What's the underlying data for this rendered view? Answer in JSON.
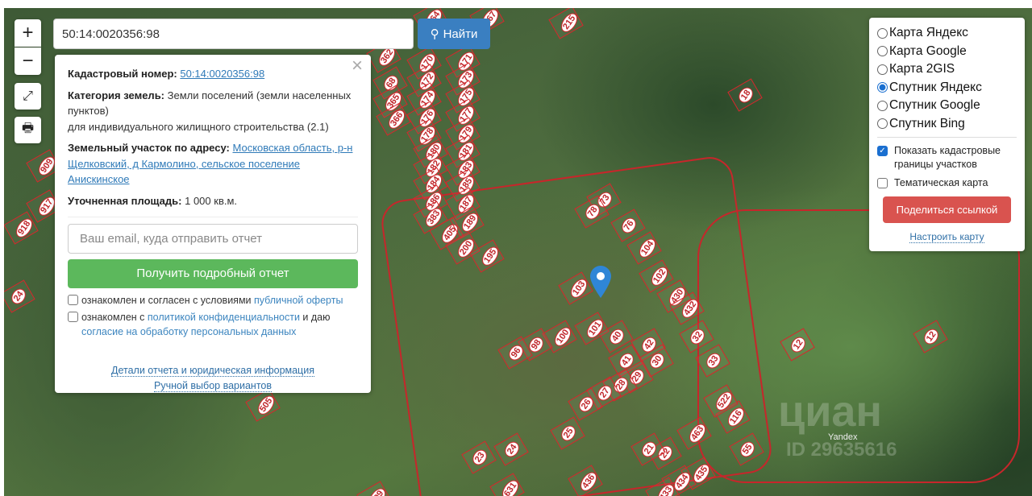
{
  "search": {
    "value": "50:14:0020356:98",
    "button": "Найти"
  },
  "map_controls": {
    "zoom_in": "+",
    "zoom_out": "−"
  },
  "info": {
    "cadastral_label": "Кадастровый номер:",
    "cadastral_value": "50:14:0020356:98",
    "category_label": "Категория земель:",
    "category_value": "Земли поселений (земли населенных пунктов)",
    "category_use": "для индивидуального жилищного строительства (2.1)",
    "address_label": "Земельный участок по адресу:",
    "address_value": "Московская область, р-н Щелковский, д Кармолино, сельское поселение Анискинское",
    "area_label": "Уточненная площадь:",
    "area_value": "1 000 кв.м.",
    "email_placeholder": "Ваш email, куда отправить отчет",
    "get_report": "Получить подробный отчет",
    "agree1_text": "ознакомлен и согласен с условиями ",
    "agree1_link": "публичной оферты",
    "agree2_text": "ознакомлен с ",
    "agree2_link": "политикой конфиденциальности",
    "agree2_mid": " и даю ",
    "agree2_link2": "согласие на обработку персональных данных",
    "details_link": "Детали отчета и юридическая информация",
    "manual_link": "Ручной выбор вариантов"
  },
  "layers": {
    "options": [
      {
        "label": "Карта Яндекс",
        "selected": false
      },
      {
        "label": "Карта Google",
        "selected": false
      },
      {
        "label": "Карта 2GIS",
        "selected": false
      },
      {
        "label": "Спутник Яндекс",
        "selected": true
      },
      {
        "label": "Спутник Google",
        "selected": false
      },
      {
        "label": "Спутник Bing",
        "selected": false
      }
    ],
    "show_boundaries": "Показать кадастровые границы участков",
    "show_boundaries_checked": true,
    "thematic": "Тематическая карта",
    "thematic_checked": false,
    "share": "Поделиться ссылкой",
    "configure": "Настроить карту"
  },
  "parcels": [
    "164",
    "167",
    "215",
    "362",
    "170",
    "171",
    "68",
    "172",
    "173",
    "365",
    "174",
    "175",
    "366",
    "176",
    "177",
    "178",
    "179",
    "180",
    "181",
    "182",
    "183",
    "184",
    "185",
    "186",
    "187",
    "383",
    "405",
    "189",
    "200",
    "195",
    "18",
    "12",
    "12",
    "73",
    "76",
    "78",
    "104",
    "102",
    "430",
    "432",
    "103",
    "101",
    "100",
    "98",
    "96",
    "40",
    "41",
    "42",
    "32",
    "33",
    "30",
    "29",
    "28",
    "27",
    "26",
    "25",
    "24",
    "23",
    "22",
    "21",
    "116",
    "522",
    "463",
    "55",
    "435",
    "434",
    "433",
    "436",
    "505",
    "509",
    "631",
    "917",
    "918",
    "909",
    "24"
  ],
  "map_attribution": "Yandex",
  "watermark": {
    "brand": "циан",
    "id": "ID 29635616"
  },
  "colors": {
    "parcel_border": "#d7262b",
    "find_button": "#3a7fc1",
    "report_button": "#5cb85c",
    "share_button": "#d9534f"
  }
}
